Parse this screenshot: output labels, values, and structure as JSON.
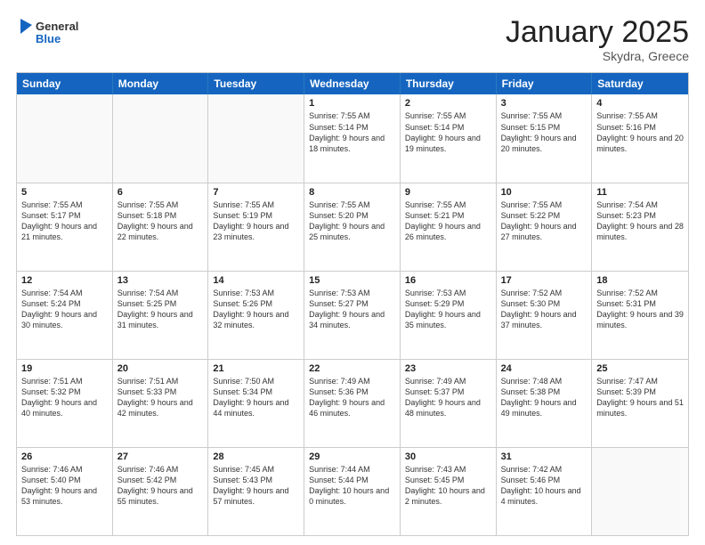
{
  "logo": {
    "general": "General",
    "blue": "Blue"
  },
  "header": {
    "month": "January 2025",
    "location": "Skydra, Greece"
  },
  "day_headers": [
    "Sunday",
    "Monday",
    "Tuesday",
    "Wednesday",
    "Thursday",
    "Friday",
    "Saturday"
  ],
  "weeks": [
    [
      {
        "day": "",
        "empty": true,
        "sunrise": "",
        "sunset": "",
        "daylight": ""
      },
      {
        "day": "",
        "empty": true,
        "sunrise": "",
        "sunset": "",
        "daylight": ""
      },
      {
        "day": "",
        "empty": true,
        "sunrise": "",
        "sunset": "",
        "daylight": ""
      },
      {
        "day": "1",
        "sunrise": "Sunrise: 7:55 AM",
        "sunset": "Sunset: 5:14 PM",
        "daylight": "Daylight: 9 hours and 18 minutes."
      },
      {
        "day": "2",
        "sunrise": "Sunrise: 7:55 AM",
        "sunset": "Sunset: 5:14 PM",
        "daylight": "Daylight: 9 hours and 19 minutes."
      },
      {
        "day": "3",
        "sunrise": "Sunrise: 7:55 AM",
        "sunset": "Sunset: 5:15 PM",
        "daylight": "Daylight: 9 hours and 20 minutes."
      },
      {
        "day": "4",
        "sunrise": "Sunrise: 7:55 AM",
        "sunset": "Sunset: 5:16 PM",
        "daylight": "Daylight: 9 hours and 20 minutes."
      }
    ],
    [
      {
        "day": "5",
        "sunrise": "Sunrise: 7:55 AM",
        "sunset": "Sunset: 5:17 PM",
        "daylight": "Daylight: 9 hours and 21 minutes."
      },
      {
        "day": "6",
        "sunrise": "Sunrise: 7:55 AM",
        "sunset": "Sunset: 5:18 PM",
        "daylight": "Daylight: 9 hours and 22 minutes."
      },
      {
        "day": "7",
        "sunrise": "Sunrise: 7:55 AM",
        "sunset": "Sunset: 5:19 PM",
        "daylight": "Daylight: 9 hours and 23 minutes."
      },
      {
        "day": "8",
        "sunrise": "Sunrise: 7:55 AM",
        "sunset": "Sunset: 5:20 PM",
        "daylight": "Daylight: 9 hours and 25 minutes."
      },
      {
        "day": "9",
        "sunrise": "Sunrise: 7:55 AM",
        "sunset": "Sunset: 5:21 PM",
        "daylight": "Daylight: 9 hours and 26 minutes."
      },
      {
        "day": "10",
        "sunrise": "Sunrise: 7:55 AM",
        "sunset": "Sunset: 5:22 PM",
        "daylight": "Daylight: 9 hours and 27 minutes."
      },
      {
        "day": "11",
        "sunrise": "Sunrise: 7:54 AM",
        "sunset": "Sunset: 5:23 PM",
        "daylight": "Daylight: 9 hours and 28 minutes."
      }
    ],
    [
      {
        "day": "12",
        "sunrise": "Sunrise: 7:54 AM",
        "sunset": "Sunset: 5:24 PM",
        "daylight": "Daylight: 9 hours and 30 minutes."
      },
      {
        "day": "13",
        "sunrise": "Sunrise: 7:54 AM",
        "sunset": "Sunset: 5:25 PM",
        "daylight": "Daylight: 9 hours and 31 minutes."
      },
      {
        "day": "14",
        "sunrise": "Sunrise: 7:53 AM",
        "sunset": "Sunset: 5:26 PM",
        "daylight": "Daylight: 9 hours and 32 minutes."
      },
      {
        "day": "15",
        "sunrise": "Sunrise: 7:53 AM",
        "sunset": "Sunset: 5:27 PM",
        "daylight": "Daylight: 9 hours and 34 minutes."
      },
      {
        "day": "16",
        "sunrise": "Sunrise: 7:53 AM",
        "sunset": "Sunset: 5:29 PM",
        "daylight": "Daylight: 9 hours and 35 minutes."
      },
      {
        "day": "17",
        "sunrise": "Sunrise: 7:52 AM",
        "sunset": "Sunset: 5:30 PM",
        "daylight": "Daylight: 9 hours and 37 minutes."
      },
      {
        "day": "18",
        "sunrise": "Sunrise: 7:52 AM",
        "sunset": "Sunset: 5:31 PM",
        "daylight": "Daylight: 9 hours and 39 minutes."
      }
    ],
    [
      {
        "day": "19",
        "sunrise": "Sunrise: 7:51 AM",
        "sunset": "Sunset: 5:32 PM",
        "daylight": "Daylight: 9 hours and 40 minutes."
      },
      {
        "day": "20",
        "sunrise": "Sunrise: 7:51 AM",
        "sunset": "Sunset: 5:33 PM",
        "daylight": "Daylight: 9 hours and 42 minutes."
      },
      {
        "day": "21",
        "sunrise": "Sunrise: 7:50 AM",
        "sunset": "Sunset: 5:34 PM",
        "daylight": "Daylight: 9 hours and 44 minutes."
      },
      {
        "day": "22",
        "sunrise": "Sunrise: 7:49 AM",
        "sunset": "Sunset: 5:36 PM",
        "daylight": "Daylight: 9 hours and 46 minutes."
      },
      {
        "day": "23",
        "sunrise": "Sunrise: 7:49 AM",
        "sunset": "Sunset: 5:37 PM",
        "daylight": "Daylight: 9 hours and 48 minutes."
      },
      {
        "day": "24",
        "sunrise": "Sunrise: 7:48 AM",
        "sunset": "Sunset: 5:38 PM",
        "daylight": "Daylight: 9 hours and 49 minutes."
      },
      {
        "day": "25",
        "sunrise": "Sunrise: 7:47 AM",
        "sunset": "Sunset: 5:39 PM",
        "daylight": "Daylight: 9 hours and 51 minutes."
      }
    ],
    [
      {
        "day": "26",
        "sunrise": "Sunrise: 7:46 AM",
        "sunset": "Sunset: 5:40 PM",
        "daylight": "Daylight: 9 hours and 53 minutes."
      },
      {
        "day": "27",
        "sunrise": "Sunrise: 7:46 AM",
        "sunset": "Sunset: 5:42 PM",
        "daylight": "Daylight: 9 hours and 55 minutes."
      },
      {
        "day": "28",
        "sunrise": "Sunrise: 7:45 AM",
        "sunset": "Sunset: 5:43 PM",
        "daylight": "Daylight: 9 hours and 57 minutes."
      },
      {
        "day": "29",
        "sunrise": "Sunrise: 7:44 AM",
        "sunset": "Sunset: 5:44 PM",
        "daylight": "Daylight: 10 hours and 0 minutes."
      },
      {
        "day": "30",
        "sunrise": "Sunrise: 7:43 AM",
        "sunset": "Sunset: 5:45 PM",
        "daylight": "Daylight: 10 hours and 2 minutes."
      },
      {
        "day": "31",
        "sunrise": "Sunrise: 7:42 AM",
        "sunset": "Sunset: 5:46 PM",
        "daylight": "Daylight: 10 hours and 4 minutes."
      },
      {
        "day": "",
        "empty": true,
        "sunrise": "",
        "sunset": "",
        "daylight": ""
      }
    ]
  ]
}
